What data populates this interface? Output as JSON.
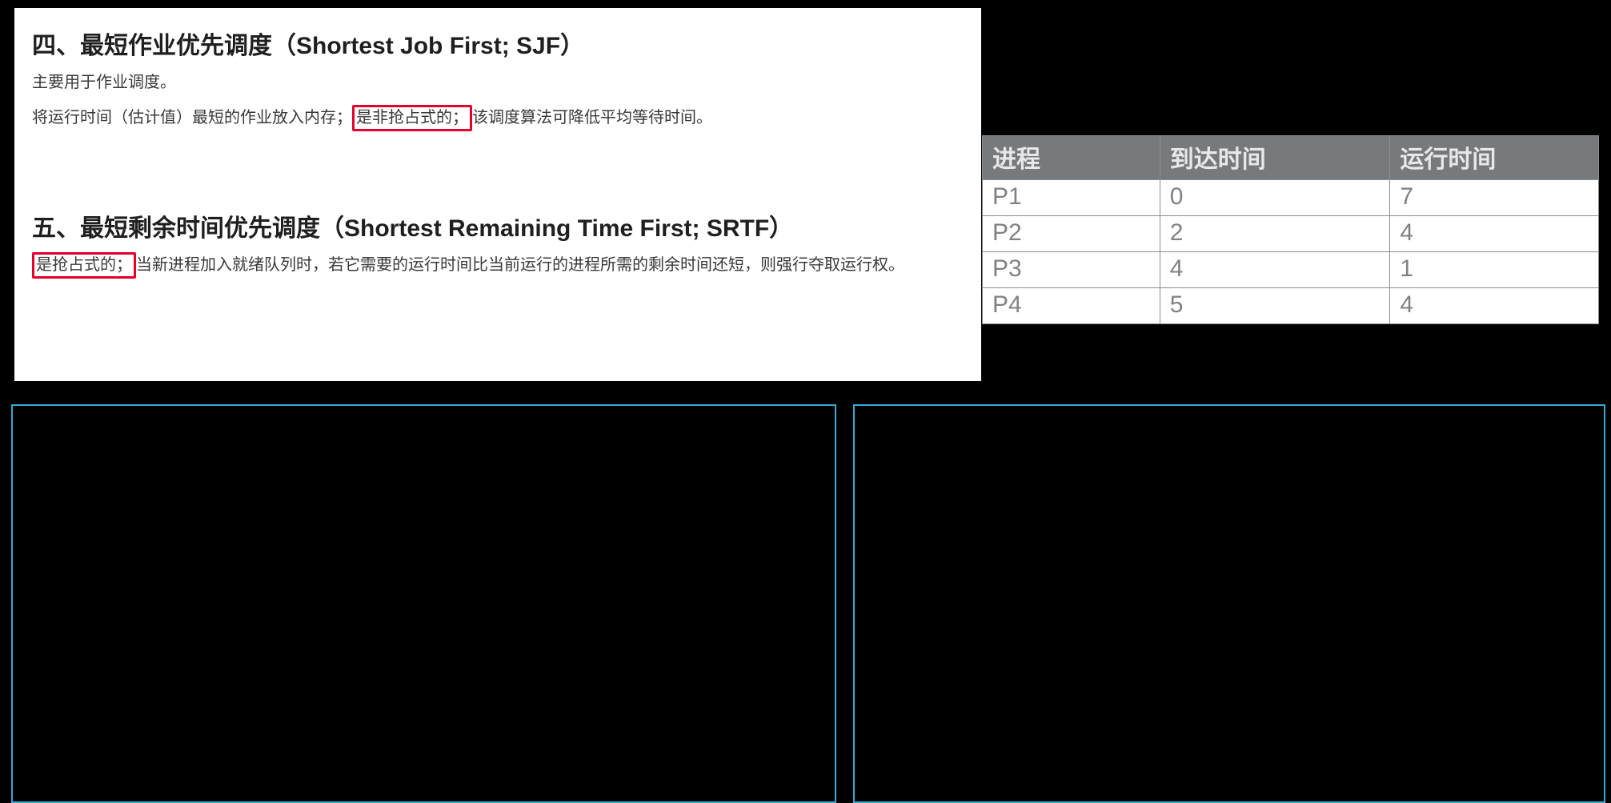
{
  "article": {
    "section4": {
      "heading": "四、最短作业优先调度（Shortest Job First; SJF）",
      "p1": "主要用于作业调度。",
      "p2_prefix": "将运行时间（估计值）最短的作业放入内存；",
      "p2_box": "是非抢占式的；",
      "p2_suffix": "该调度算法可降低平均等待时间。"
    },
    "section5": {
      "heading": "五、最短剩余时间优先调度（Shortest Remaining Time First; SRTF）",
      "p1_box": "是抢占式的；",
      "p1_rest": "当新进程加入就绪队列时，若它需要的运行时间比当前运行的进程所需的剩余时间还短，则强行夺取运行权。"
    }
  },
  "table": {
    "headers": {
      "c1": "进程",
      "c2": "到达时间",
      "c3": "运行时间"
    },
    "rows": [
      {
        "c1": "P1",
        "c2": "0",
        "c3": "7"
      },
      {
        "c1": "P2",
        "c2": "2",
        "c3": "4"
      },
      {
        "c1": "P3",
        "c2": "4",
        "c3": "1"
      },
      {
        "c1": "P4",
        "c2": "5",
        "c3": "4"
      }
    ]
  }
}
